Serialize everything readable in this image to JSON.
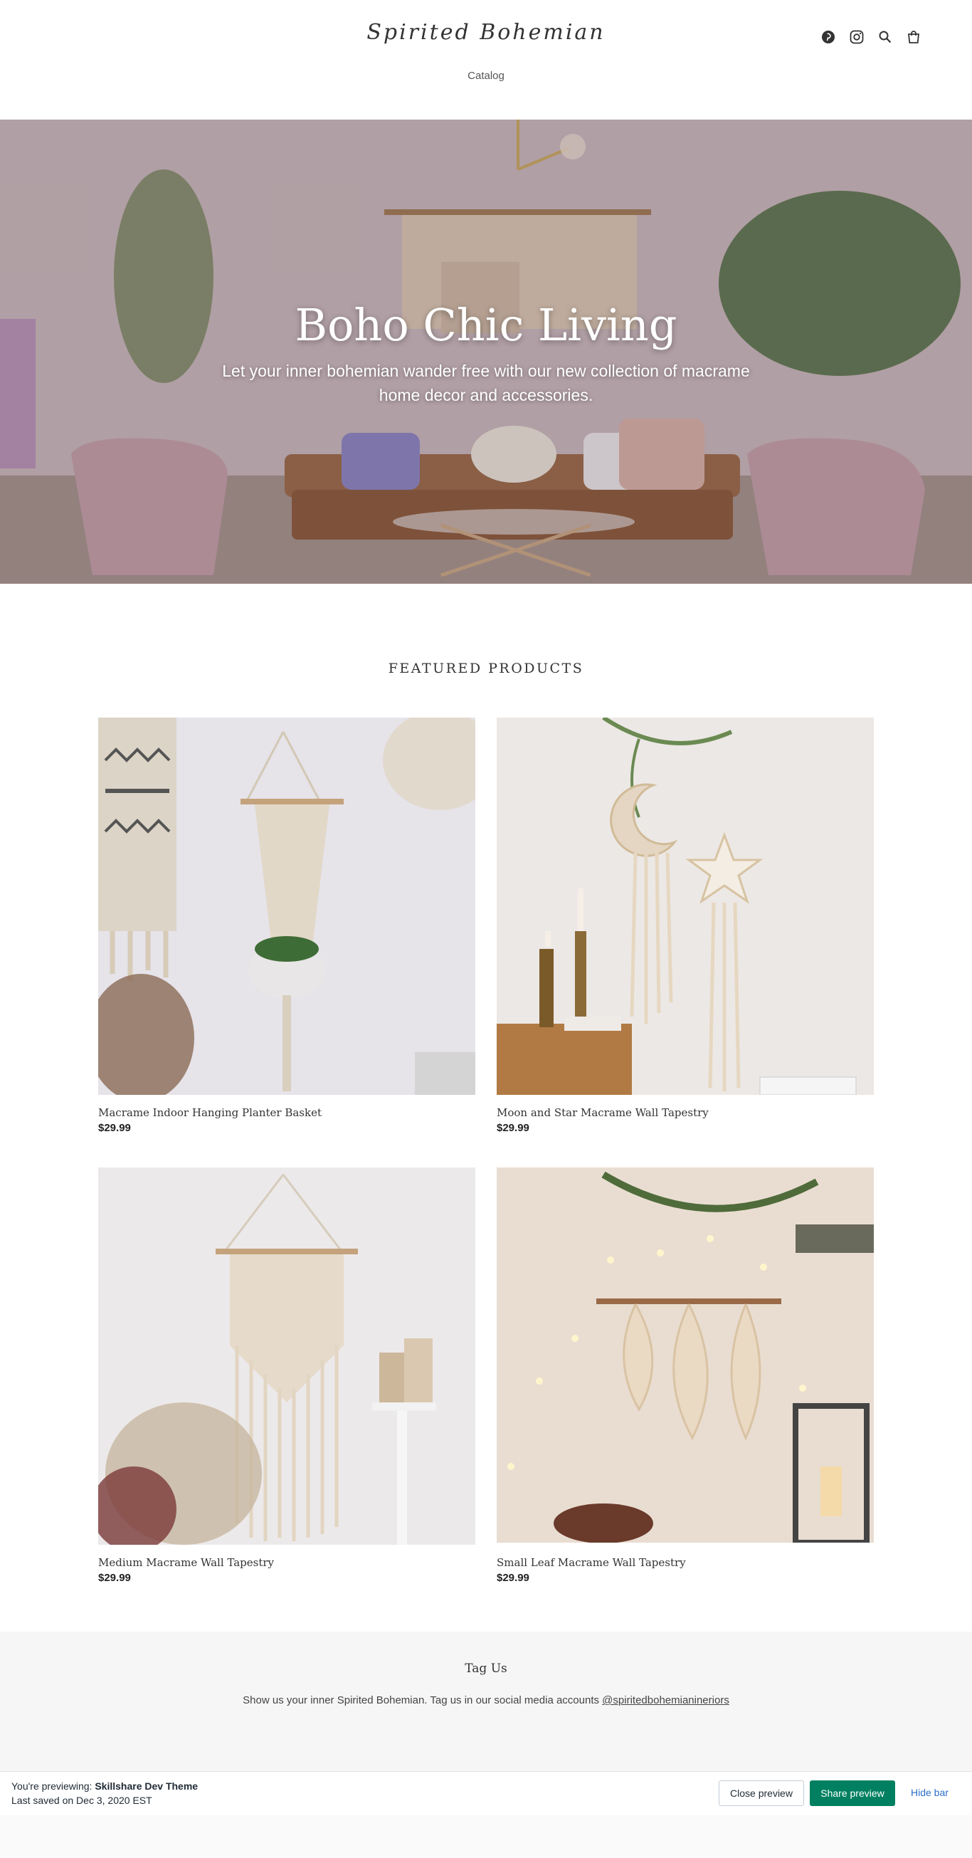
{
  "header": {
    "logo": "Spirited Bohemian",
    "nav": [
      {
        "label": "Catalog"
      }
    ],
    "icons": [
      "pinterest-icon",
      "instagram-icon",
      "search-icon",
      "cart-icon"
    ]
  },
  "hero": {
    "title": "Boho Chic Living",
    "subtitle": "Let your inner bohemian wander free with our new collection of macrame home decor and accessories."
  },
  "featured": {
    "title": "FEATURED PRODUCTS",
    "products": [
      {
        "name": "Macrame Indoor Hanging Planter Basket",
        "price": "$29.99"
      },
      {
        "name": "Moon and Star Macrame Wall Tapestry",
        "price": "$29.99"
      },
      {
        "name": "Medium Macrame Wall Tapestry",
        "price": "$29.99"
      },
      {
        "name": "Small Leaf Macrame Wall Tapestry",
        "price": "$29.99"
      }
    ]
  },
  "tag_us": {
    "title": "Tag Us",
    "text": "Show us your inner Spirited Bohemian. Tag us in our social media accounts",
    "handle": "@spiritedbohemianineriors"
  },
  "preview_bar": {
    "previewing_label": "You're previewing:",
    "theme_name": "Skillshare Dev Theme",
    "last_saved": "Last saved on Dec 3, 2020 EST",
    "close_label": "Close preview",
    "share_label": "Share preview",
    "hide_label": "Hide bar"
  },
  "colors": {
    "share_button": "#008060",
    "hide_link": "#2c6ecb",
    "tag_band": "#f6f6f6"
  }
}
